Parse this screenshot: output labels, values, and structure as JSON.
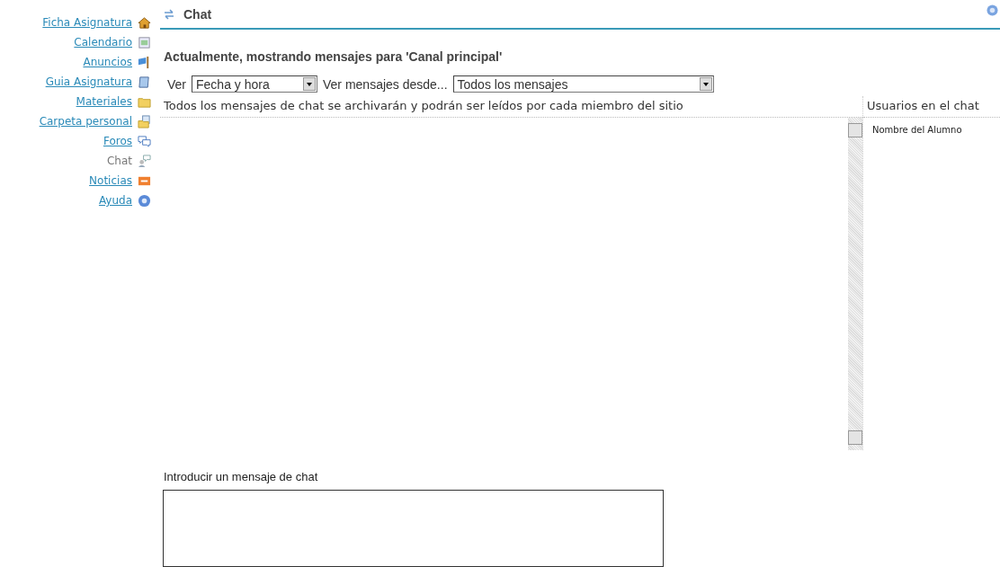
{
  "sidebar": {
    "items": [
      {
        "label": "Ficha Asignatura",
        "kind": "home",
        "selected": false
      },
      {
        "label": "Calendario",
        "kind": "calendar",
        "selected": false
      },
      {
        "label": "Anuncios",
        "kind": "flag",
        "selected": false
      },
      {
        "label": "Guia Asignatura",
        "kind": "book",
        "selected": false
      },
      {
        "label": "Materiales",
        "kind": "folder",
        "selected": false
      },
      {
        "label": "Carpeta personal",
        "kind": "folderdoc",
        "selected": false
      },
      {
        "label": "Foros",
        "kind": "bubbles",
        "selected": false
      },
      {
        "label": "Chat",
        "kind": "chat",
        "selected": true
      },
      {
        "label": "Noticias",
        "kind": "rss",
        "selected": false
      },
      {
        "label": "Ayuda",
        "kind": "help",
        "selected": false
      }
    ]
  },
  "header": {
    "title": "Chat"
  },
  "heading": "Actualmente, mostrando mensajes para 'Canal principal'",
  "filters": {
    "view_label": "Ver",
    "view_value": "Fecha y hora",
    "since_label": "Ver mensajes desde...",
    "since_value": "Todos los mensajes"
  },
  "notice": "Todos los mensajes de chat se archivarán y podrán ser leídos por cada miembro del sitio",
  "users": {
    "title": "Usuarios en el chat",
    "items": [
      "Nombre del Alumno"
    ]
  },
  "composer": {
    "label": "Introducir un mensaje de chat"
  }
}
